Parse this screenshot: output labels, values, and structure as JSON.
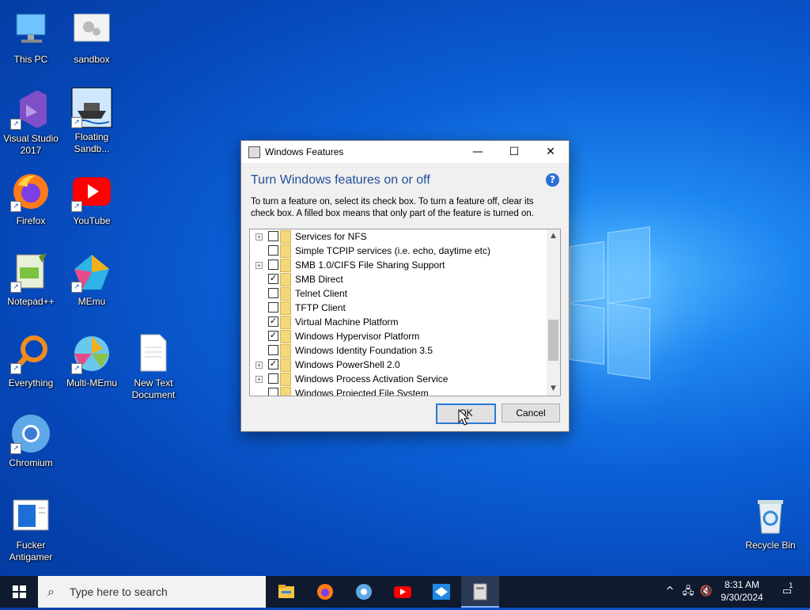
{
  "desktop": {
    "icons": [
      {
        "label": "This PC"
      },
      {
        "label": "sandbox"
      },
      {
        "label": "Visual Studio 2017"
      },
      {
        "label": "Floating Sandb..."
      },
      {
        "label": "Firefox"
      },
      {
        "label": "YouTube"
      },
      {
        "label": "Notepad++"
      },
      {
        "label": "MEmu"
      },
      {
        "label": "Everything"
      },
      {
        "label": "Multi-MEmu"
      },
      {
        "label": "New Text Document"
      },
      {
        "label": "Chromium"
      },
      {
        "label": "Fucker Antigamer"
      },
      {
        "label": "Recycle Bin"
      }
    ]
  },
  "dialog": {
    "title": "Windows Features",
    "heading": "Turn Windows features on or off",
    "description": "To turn a feature on, select its check box. To turn a feature off, clear its check box. A filled box means that only part of the feature is turned on.",
    "features": [
      {
        "label": "Services for NFS",
        "expandable": true,
        "checked": false
      },
      {
        "label": "Simple TCPIP services (i.e. echo, daytime etc)",
        "expandable": false,
        "checked": false
      },
      {
        "label": "SMB 1.0/CIFS File Sharing Support",
        "expandable": true,
        "checked": false
      },
      {
        "label": "SMB Direct",
        "expandable": false,
        "checked": true
      },
      {
        "label": "Telnet Client",
        "expandable": false,
        "checked": false
      },
      {
        "label": "TFTP Client",
        "expandable": false,
        "checked": false
      },
      {
        "label": "Virtual Machine Platform",
        "expandable": false,
        "checked": true
      },
      {
        "label": "Windows Hypervisor Platform",
        "expandable": false,
        "checked": true
      },
      {
        "label": "Windows Identity Foundation 3.5",
        "expandable": false,
        "checked": false
      },
      {
        "label": "Windows PowerShell 2.0",
        "expandable": true,
        "checked": true
      },
      {
        "label": "Windows Process Activation Service",
        "expandable": true,
        "checked": false
      },
      {
        "label": "Windows Projected File System",
        "expandable": false,
        "checked": false
      }
    ],
    "ok_label": "OK",
    "cancel_label": "Cancel",
    "minimize_glyph": "—",
    "maximize_glyph": "☐",
    "close_glyph": "✕",
    "help_glyph": "?"
  },
  "taskbar": {
    "search_placeholder": "Type here to search",
    "time": "8:31 AM",
    "date": "9/30/2024",
    "notification_count": "1",
    "apps": [
      "file-explorer-icon",
      "firefox-icon",
      "chromium-icon",
      "youtube-icon",
      "sandbox-app-icon",
      "windows-features-icon"
    ]
  },
  "colors": {
    "accent": "#2a7ad5",
    "heading": "#1f4e9a",
    "taskbar": "#0f1a2e"
  }
}
